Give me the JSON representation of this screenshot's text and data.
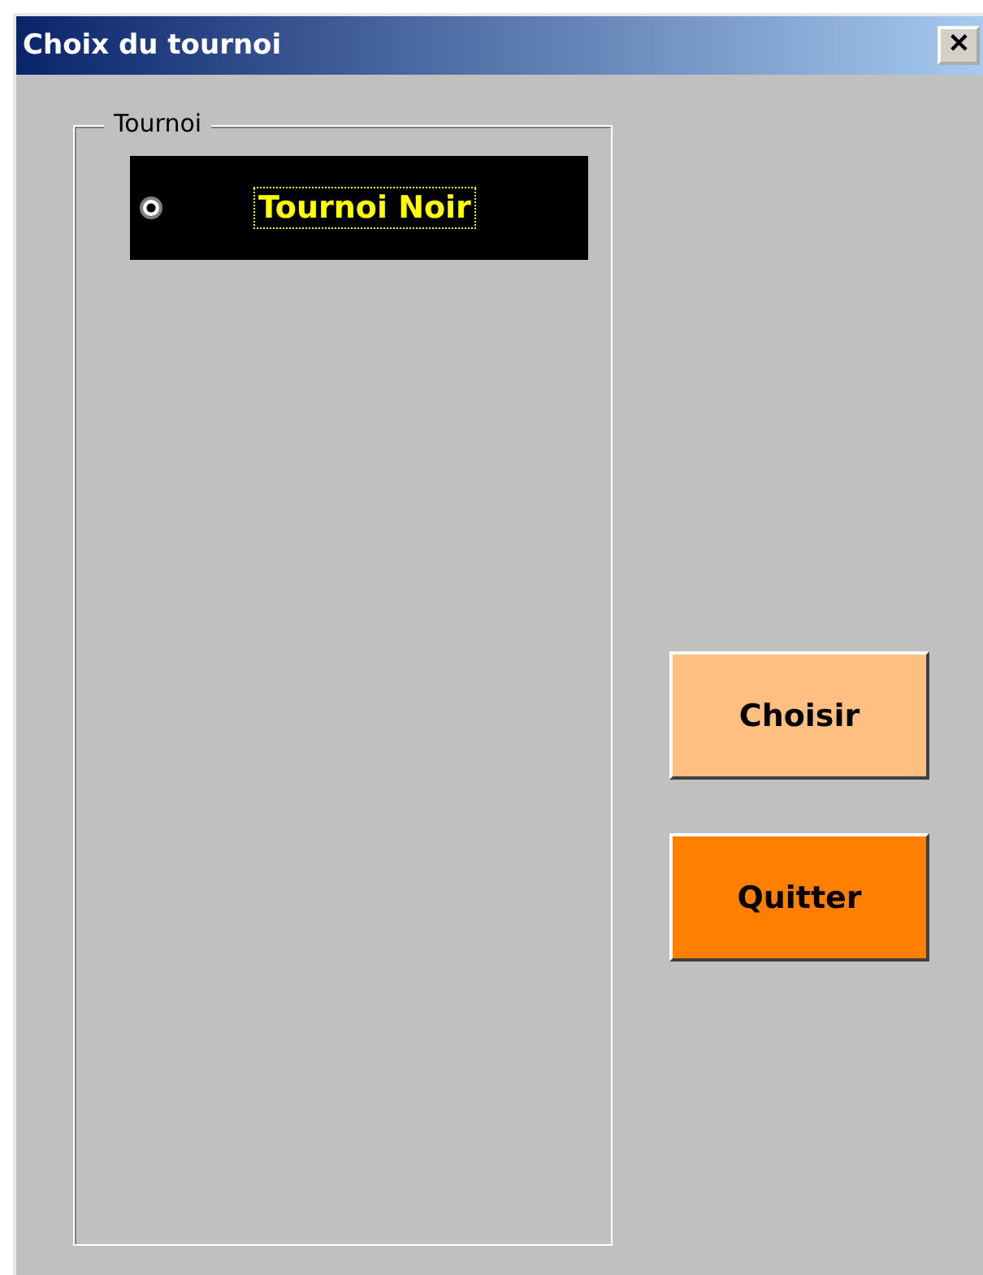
{
  "window": {
    "title": "Choix du tournoi",
    "close_label": "✕"
  },
  "group": {
    "label": "Tournoi",
    "options": [
      {
        "label": "Tournoi Noir",
        "selected": true
      }
    ]
  },
  "buttons": [
    {
      "label": "Choisir",
      "color": "#ffbf80"
    },
    {
      "label": "Quitter",
      "color": "#ff8000"
    }
  ]
}
